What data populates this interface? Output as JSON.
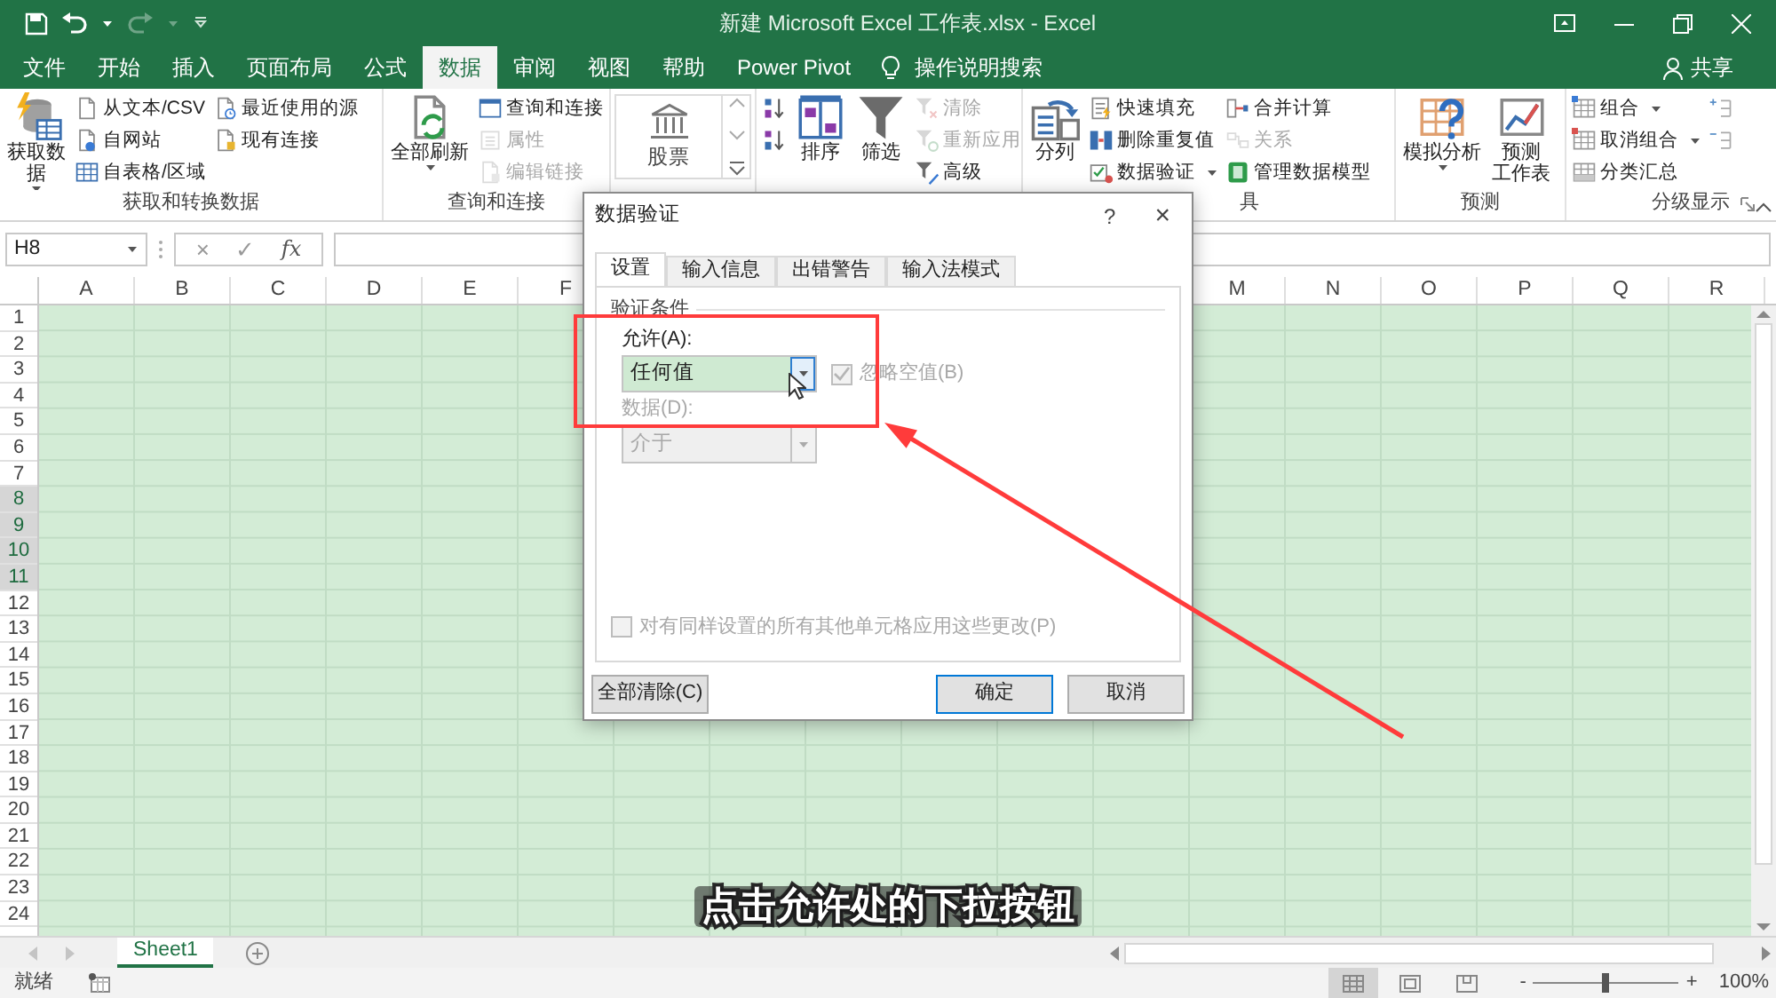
{
  "title_bar": {
    "title": "新建 Microsoft Excel 工作表.xlsx - Excel"
  },
  "tabs": [
    {
      "label": "文件",
      "selected": false
    },
    {
      "label": "开始",
      "selected": false
    },
    {
      "label": "插入",
      "selected": false
    },
    {
      "label": "页面布局",
      "selected": false
    },
    {
      "label": "公式",
      "selected": false
    },
    {
      "label": "数据",
      "selected": true
    },
    {
      "label": "审阅",
      "selected": false
    },
    {
      "label": "视图",
      "selected": false
    },
    {
      "label": "帮助",
      "selected": false
    },
    {
      "label": "Power Pivot",
      "selected": false
    }
  ],
  "tell_me": "操作说明搜索",
  "share": "共享",
  "ribbon": {
    "groups": [
      {
        "label": "获取和转换数据",
        "items": [
          {
            "kind": "large",
            "lines": [
              "获取数",
              "据"
            ],
            "dropdown": true,
            "disabled": false
          },
          {
            "kind": "stack",
            "items": [
              {
                "label": "从文本/CSV",
                "dropdown": false,
                "disabled": false
              },
              {
                "label": "自网站",
                "dropdown": false,
                "disabled": false
              },
              {
                "label": "自表格/区域",
                "dropdown": false,
                "disabled": false
              }
            ]
          },
          {
            "kind": "stack",
            "items": [
              {
                "label": "最近使用的源",
                "dropdown": false,
                "disabled": false
              },
              {
                "label": "现有连接",
                "dropdown": false,
                "disabled": false
              }
            ]
          }
        ]
      },
      {
        "label": "查询和连接",
        "items": [
          {
            "kind": "large",
            "lines": [
              "全部刷新"
            ],
            "dropdown": true,
            "disabled": false
          },
          {
            "kind": "stack",
            "items": [
              {
                "label": "查询和连接",
                "dropdown": false,
                "disabled": false
              },
              {
                "label": "属性",
                "dropdown": false,
                "disabled": true
              },
              {
                "label": "编辑链接",
                "dropdown": false,
                "disabled": true
              }
            ]
          }
        ]
      },
      {
        "items": [
          {
            "kind": "gallery",
            "label": "股票"
          }
        ]
      },
      {
        "items": [
          {
            "kind": "stack",
            "items": [
              {
                "dropdown": false,
                "disabled": false
              },
              {
                "dropdown": false,
                "disabled": false
              }
            ]
          },
          {
            "kind": "large",
            "lines": [
              "排序"
            ],
            "dropdown": false,
            "disabled": false
          },
          {
            "kind": "large",
            "lines": [
              "筛选"
            ],
            "dropdown": false,
            "disabled": false
          },
          {
            "kind": "stack",
            "items": [
              {
                "label": "清除",
                "dropdown": false,
                "disabled": true
              },
              {
                "label": "重新应用",
                "dropdown": false,
                "disabled": true
              },
              {
                "label": "高级",
                "dropdown": false,
                "disabled": false
              }
            ]
          }
        ]
      },
      {
        "label": "具",
        "items": [
          {
            "kind": "large",
            "lines": [
              "分列"
            ],
            "dropdown": false,
            "disabled": false
          },
          {
            "kind": "stack",
            "items": [
              {
                "label": "快速填充",
                "dropdown": false,
                "disabled": false
              },
              {
                "label": "删除重复值",
                "dropdown": false,
                "disabled": false
              },
              {
                "label": "数据验证",
                "dropdown": true,
                "disabled": false
              }
            ]
          },
          {
            "kind": "stack",
            "items": [
              {
                "label": "合并计算",
                "dropdown": false,
                "disabled": false
              },
              {
                "label": "关系",
                "dropdown": false,
                "disabled": true
              },
              {
                "label": "管理数据模型",
                "dropdown": false,
                "disabled": false
              }
            ]
          }
        ]
      },
      {
        "label": "预测",
        "items": [
          {
            "kind": "large",
            "lines": [
              "模拟分析"
            ],
            "dropdown": true,
            "disabled": false
          },
          {
            "kind": "large",
            "lines": [
              "预测",
              "工作表"
            ],
            "dropdown": false,
            "disabled": false
          }
        ]
      },
      {
        "label": "分级显示",
        "launcher": true,
        "items": [
          {
            "kind": "stack",
            "items": [
              {
                "label": "组合",
                "dropdown": true,
                "disabled": false
              },
              {
                "label": "取消组合",
                "dropdown": true,
                "disabled": false
              },
              {
                "label": "分类汇总",
                "dropdown": false,
                "disabled": false
              }
            ]
          },
          {
            "kind": "stack",
            "items": [
              {
                "dropdown": false,
                "disabled": false
              },
              {
                "dropdown": false,
                "disabled": false
              }
            ]
          }
        ]
      }
    ]
  },
  "formula_bar": {
    "name_box": "H8",
    "cancel": "×",
    "enter": "✓",
    "fx": "fx"
  },
  "sheet": {
    "columns": [
      "A",
      "B",
      "C",
      "D",
      "E",
      "F",
      null,
      null,
      null,
      null,
      null,
      null,
      "M",
      "N",
      "O",
      "P",
      "Q",
      "R"
    ],
    "rows": [
      {
        "label": "1",
        "selected": false
      },
      {
        "label": "2",
        "selected": false
      },
      {
        "label": "3",
        "selected": false
      },
      {
        "label": "4",
        "selected": false
      },
      {
        "label": "5",
        "selected": false
      },
      {
        "label": "6",
        "selected": false
      },
      {
        "label": "7",
        "selected": false
      },
      {
        "label": "8",
        "selected": true
      },
      {
        "label": "9",
        "selected": true
      },
      {
        "label": "10",
        "selected": true
      },
      {
        "label": "11",
        "selected": true
      },
      {
        "label": "12",
        "selected": false
      },
      {
        "label": "13",
        "selected": false
      },
      {
        "label": "14",
        "selected": false
      },
      {
        "label": "15",
        "selected": false
      },
      {
        "label": "16",
        "selected": false
      },
      {
        "label": "17",
        "selected": false
      },
      {
        "label": "18",
        "selected": false
      },
      {
        "label": "19",
        "selected": false
      },
      {
        "label": "20",
        "selected": false
      },
      {
        "label": "21",
        "selected": false
      },
      {
        "label": "22",
        "selected": false
      },
      {
        "label": "23",
        "selected": false
      },
      {
        "label": "24",
        "selected": false
      }
    ]
  },
  "sheet_tabs": [
    {
      "label": "Sheet1",
      "selected": true
    }
  ],
  "status_bar": {
    "text": "就绪",
    "views": [
      {
        "selected": true
      },
      {
        "selected": false
      },
      {
        "selected": false
      }
    ],
    "zoom": {
      "minus": "-",
      "plus": "+",
      "level": 0.5,
      "reading": "100%"
    }
  },
  "dialog": {
    "title": "数据验证",
    "help": "?",
    "close": "×",
    "tabs": [
      {
        "label": "设置",
        "selected": true
      },
      {
        "label": "输入信息",
        "selected": false
      },
      {
        "label": "出错警告",
        "selected": false
      },
      {
        "label": "输入法模式",
        "selected": false
      }
    ],
    "section": "验证条件",
    "allow": {
      "label": "允许(A):",
      "value": "任何值",
      "highlighted": true
    },
    "ignore_blank": {
      "label": "忽略空值(B)",
      "checked": true,
      "disabled": true
    },
    "data": {
      "label": "数据(D):",
      "value": "介于",
      "disabled": true
    },
    "apply_all": {
      "label": "对有同样设置的所有其他单元格应用这些更改(P)",
      "checked": false,
      "disabled": true
    },
    "buttons": [
      {
        "label": "全部清除(C)",
        "default": false
      },
      {
        "label": "确定",
        "default": true
      },
      {
        "label": "取消",
        "default": false
      }
    ]
  },
  "caption": "点击允许处的下拉按钮"
}
